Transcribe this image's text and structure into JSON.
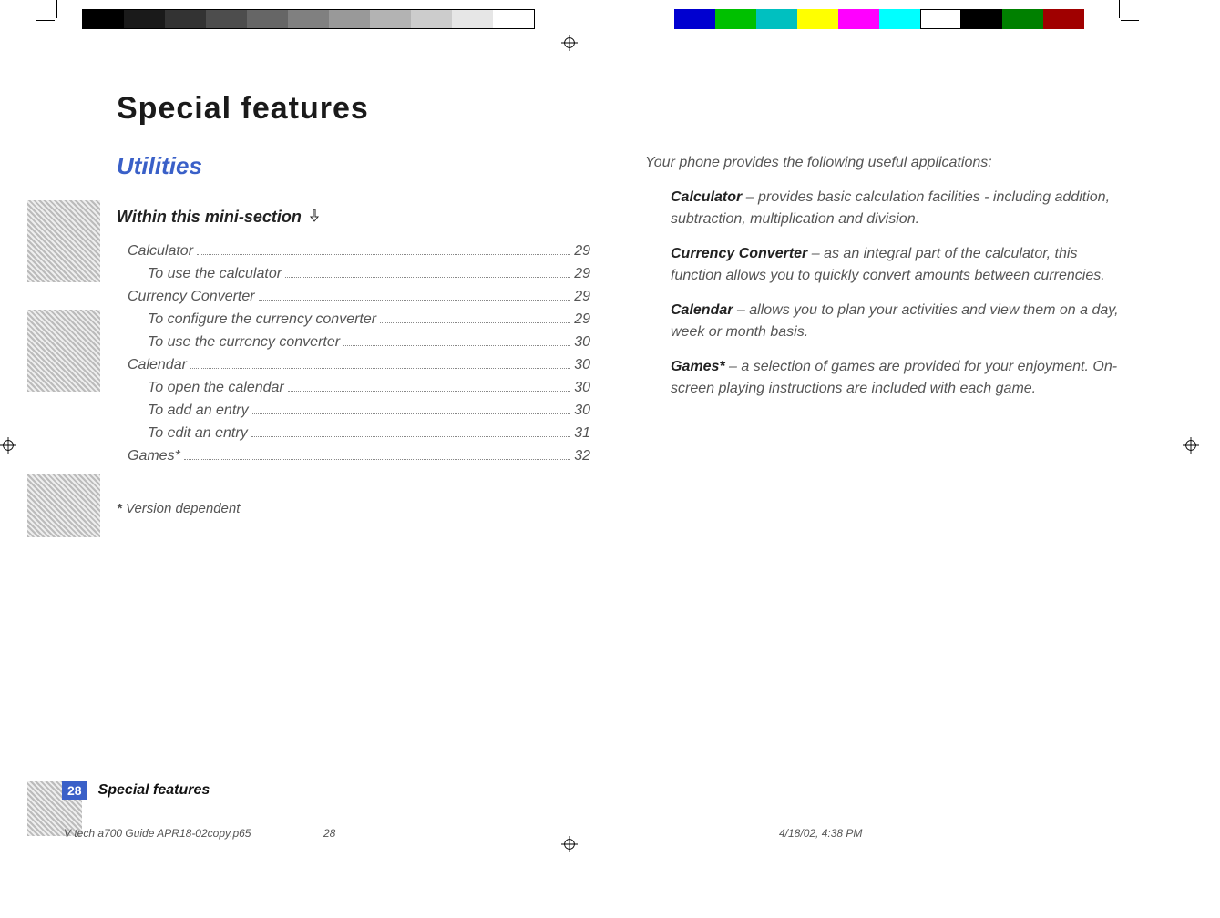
{
  "title": "Special features",
  "section": "Utilities",
  "mini_section_heading": "Within this mini-section",
  "toc": [
    {
      "label": "Calculator",
      "page": "29",
      "level": 1
    },
    {
      "label": "To use the calculator",
      "page": "29",
      "level": 2
    },
    {
      "label": "Currency Converter",
      "page": "29",
      "level": 1
    },
    {
      "label": "To configure the currency converter",
      "page": "29",
      "level": 2
    },
    {
      "label": "To use the currency converter",
      "page": "30",
      "level": 2
    },
    {
      "label": "Calendar",
      "page": "30",
      "level": 1
    },
    {
      "label": "To open the calendar",
      "page": "30",
      "level": 2
    },
    {
      "label": "To add an entry",
      "page": "30",
      "level": 2
    },
    {
      "label": "To edit an entry",
      "page": "31",
      "level": 2
    },
    {
      "label": "Games*",
      "page": "32",
      "level": 1
    }
  ],
  "footnote_marker": "*",
  "footnote_text": "Version dependent",
  "intro_lead": "Your phone provides the following useful applications:",
  "intro_items": [
    {
      "lead": "Calculator",
      "text": " –  provides basic calculation facilities - including addition, subtraction, multiplication and division."
    },
    {
      "lead": "Currency Converter",
      "text": " –  as an integral part of the calculator, this function allows you to quickly convert amounts between currencies."
    },
    {
      "lead": "Calendar",
      "text": " –  allows you to plan your activities and view them on a day, week or month basis."
    },
    {
      "lead": "Games*",
      "text": " –  a selection of games are provided for your enjoyment. On-screen playing instructions are included with each game."
    }
  ],
  "footer": {
    "page_num": "28",
    "title": "Special features"
  },
  "meta": {
    "file": "V tech a700 Guide APR18-02copy.p65",
    "page": "28",
    "timestamp": "4/18/02, 4:38 PM"
  }
}
